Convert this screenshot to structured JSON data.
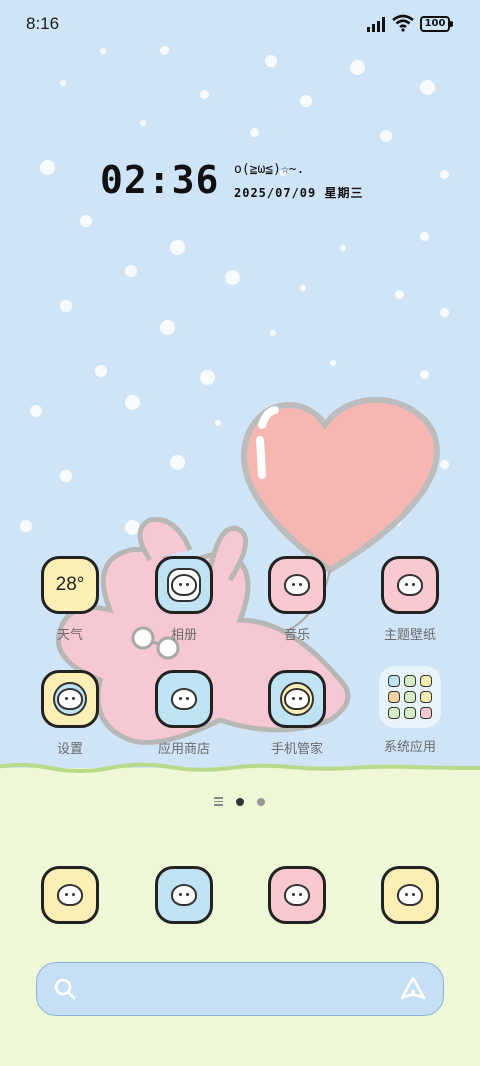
{
  "status_bar": {
    "time": "8:16",
    "battery": "100",
    "icons": [
      "signal-icon",
      "wifi-icon",
      "battery-icon"
    ]
  },
  "widget": {
    "clock": "02:36",
    "kaomoji": "o(≧ω≦)☆~.",
    "date": "2025/07/09 星期三"
  },
  "apps": [
    {
      "label": "天气",
      "value": "28°",
      "bg": "#fbefb5"
    },
    {
      "label": "相册",
      "bg": "#bfe3f2"
    },
    {
      "label": "音乐",
      "bg": "#f8c9cf"
    },
    {
      "label": "主题壁纸",
      "bg": "#f8c9cf"
    },
    {
      "label": "设置",
      "bg": "#fbefb5"
    },
    {
      "label": "应用商店",
      "bg": "#bfe3f2"
    },
    {
      "label": "手机管家",
      "bg": "#bfe3f2"
    },
    {
      "label": "系统应用"
    }
  ],
  "dock": [
    {
      "name": "phone",
      "bg": "#fbefb5"
    },
    {
      "name": "messages",
      "bg": "#bfe3f2"
    },
    {
      "name": "browser",
      "bg": "#f8c9cf"
    },
    {
      "name": "camera",
      "bg": "#fbefb5"
    }
  ],
  "pager": {
    "pages": 2,
    "current": 1
  },
  "search": {
    "icons": [
      "search-icon",
      "assistant-icon"
    ]
  },
  "colors": {
    "sky": "#cfe5f7",
    "ground": "#eef7d6",
    "balloon": "#f6b7b2",
    "bunny": "#f6c8d3",
    "search_bg": "#c7dff4"
  }
}
